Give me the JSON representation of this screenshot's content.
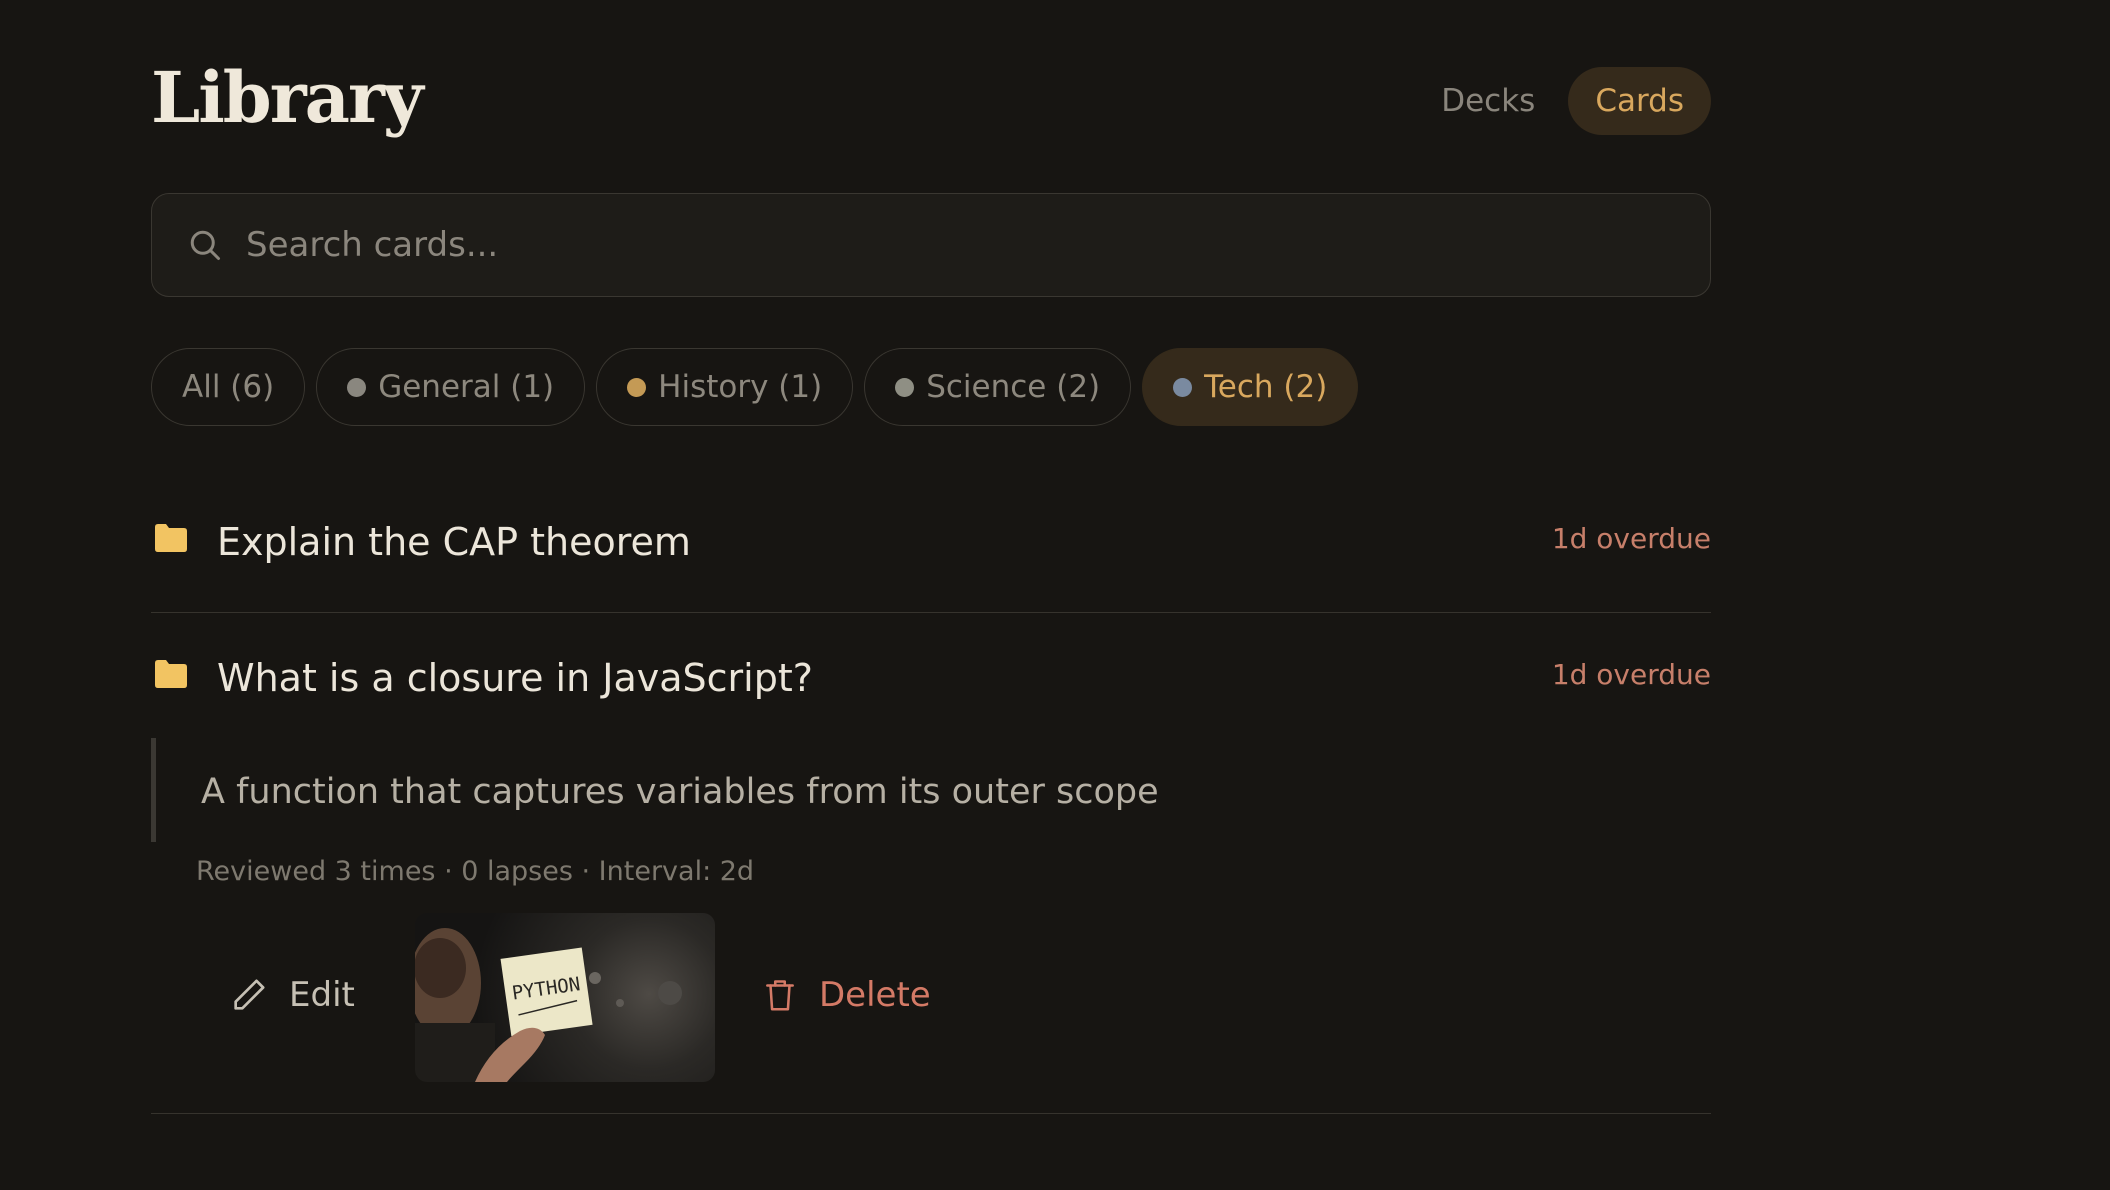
{
  "header": {
    "title": "Library",
    "tabs": [
      {
        "label": "Decks",
        "active": false
      },
      {
        "label": "Cards",
        "active": true
      }
    ]
  },
  "search": {
    "placeholder": "Search cards...",
    "value": ""
  },
  "filters": [
    {
      "label": "All (6)",
      "dot": null,
      "active": false
    },
    {
      "label": "General (1)",
      "dot": "#8a877f",
      "active": false
    },
    {
      "label": "History (1)",
      "dot": "#c49a55",
      "active": false
    },
    {
      "label": "Science (2)",
      "dot": "#8f8f84",
      "active": false
    },
    {
      "label": "Tech (2)",
      "dot": "#7a8aa0",
      "active": true
    }
  ],
  "cards": [
    {
      "question": "Explain the CAP theorem",
      "due": "1d overdue",
      "icon": "folder-icon"
    },
    {
      "question": "What is a closure in JavaScript?",
      "due": "1d overdue",
      "icon": "folder-icon",
      "answer": "A function that captures variables from its outer scope",
      "meta": "Reviewed 3 times · 0 lapses · Interval: 2d",
      "image_text": "PYTHON"
    }
  ],
  "actions": {
    "edit_label": "Edit",
    "delete_label": "Delete"
  },
  "colors": {
    "background": "#171512",
    "accent": "#d9a85e",
    "accent_bg": "#352a1b",
    "overdue": "#c77f6a",
    "delete": "#d47a66",
    "folder": "#f2c462"
  }
}
